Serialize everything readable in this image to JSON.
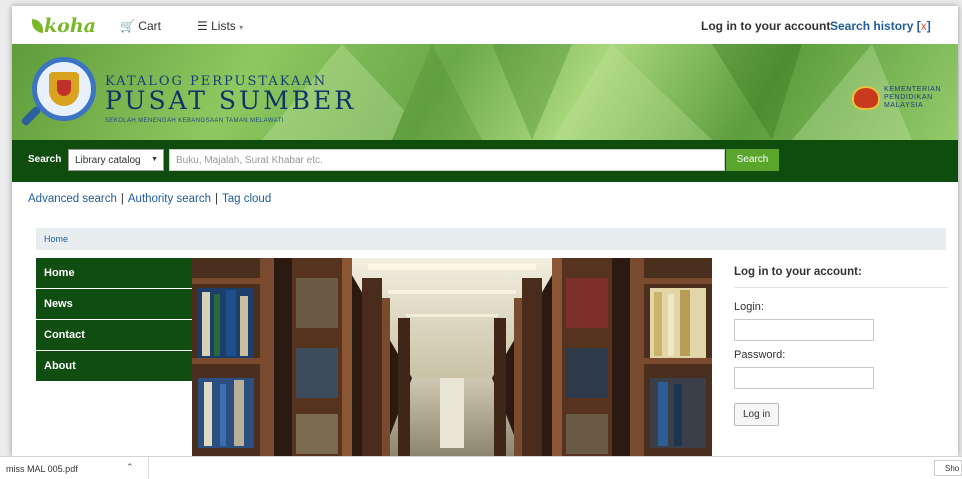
{
  "topbar": {
    "logo": "koha",
    "cart_label": "Cart",
    "lists_label": "Lists",
    "login_label": "Log in to your account",
    "history_label": "Search history",
    "history_clear": "x"
  },
  "banner": {
    "line1": "KATALOG PERPUSTAKAAN",
    "line2": "PUSAT SUMBER",
    "line3": "SEKOLAH MENENGAH KEBANGSAAN TAMAN MELAWATI",
    "ministry": [
      "KEMENTERIAN",
      "PENDIDIKAN",
      "MALAYSIA"
    ]
  },
  "search": {
    "label": "Search",
    "select_value": "Library catalog",
    "placeholder": "Buku, Majalah, Surat Khabar etc.",
    "button": "Search"
  },
  "links": [
    "Advanced search",
    "Authority search",
    "Tag cloud"
  ],
  "breadcrumb": "Home",
  "nav": [
    "Home",
    "News",
    "Contact",
    "About"
  ],
  "login": {
    "title": "Log in to your account:",
    "login_label": "Login:",
    "password_label": "Password:",
    "button": "Log in"
  },
  "downloads": {
    "file": "miss MAL 005.pdf",
    "show_all": "Sho"
  },
  "colors": {
    "accent_green": "#0e4d0e",
    "search_button": "#5aa52c",
    "link_blue": "#1f5c99",
    "koha_green": "#7ab829"
  }
}
